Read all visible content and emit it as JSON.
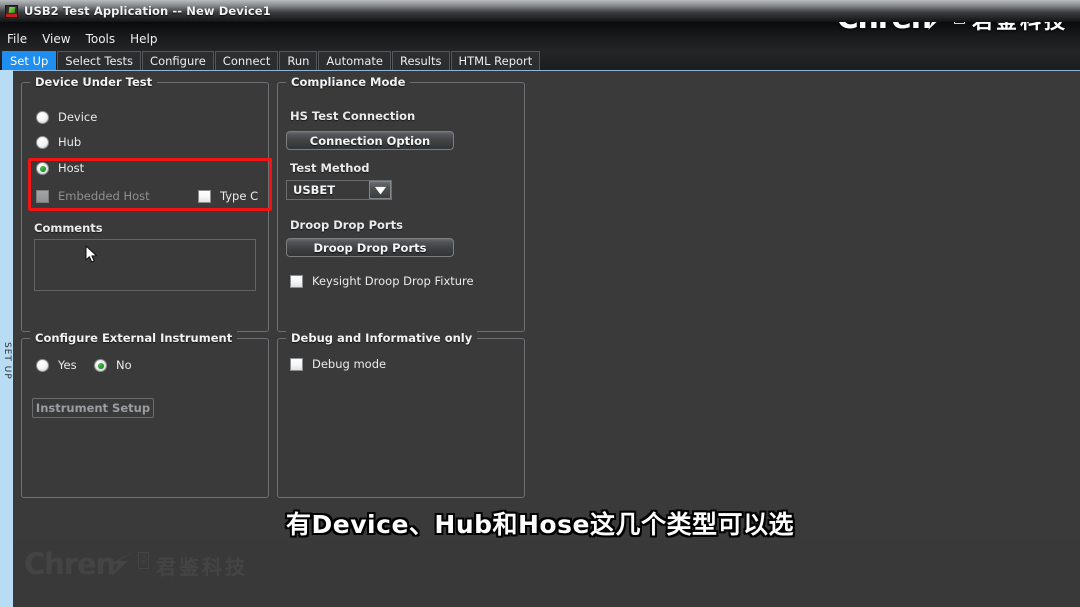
{
  "window": {
    "title": "USB2 Test Application -- New Device1",
    "icon": "app-icon"
  },
  "menubar": {
    "items": [
      {
        "label": "File"
      },
      {
        "label": "View"
      },
      {
        "label": "Tools"
      },
      {
        "label": "Help"
      }
    ]
  },
  "tabs": [
    {
      "label": "Set Up",
      "active": true
    },
    {
      "label": "Select Tests",
      "active": false
    },
    {
      "label": "Configure",
      "active": false
    },
    {
      "label": "Connect",
      "active": false
    },
    {
      "label": "Run",
      "active": false
    },
    {
      "label": "Automate",
      "active": false
    },
    {
      "label": "Results",
      "active": false
    },
    {
      "label": "HTML Report",
      "active": false
    }
  ],
  "brand": {
    "word": "Chren",
    "mark": "注册",
    "chinese": "君鉴科技"
  },
  "side_strip": {
    "label": "SET UP"
  },
  "device_under_test": {
    "title": "Device Under Test",
    "options": [
      {
        "label": "Device",
        "selected": false
      },
      {
        "label": "Hub",
        "selected": false
      },
      {
        "label": "Host",
        "selected": true
      }
    ],
    "embedded_host": {
      "label": "Embedded Host",
      "checked": false,
      "disabled": true
    },
    "type_c": {
      "label": "Type C",
      "checked": false
    },
    "comments": {
      "label": "Comments",
      "value": ""
    }
  },
  "compliance_mode": {
    "title": "Compliance Mode",
    "hs_test_connection_label": "HS Test Connection",
    "connection_option_button": "Connection Option",
    "test_method_label": "Test Method",
    "test_method_value": "USBET",
    "droop_drop_ports_label": "Droop Drop Ports",
    "droop_drop_ports_button": "Droop Drop Ports",
    "keysight_fixture": {
      "label": "Keysight Droop Drop Fixture",
      "checked": false
    }
  },
  "configure_external_instrument": {
    "title": "Configure External Instrument",
    "options": [
      {
        "label": "Yes",
        "selected": false
      },
      {
        "label": "No",
        "selected": true
      }
    ],
    "instrument_setup_button": "Instrument Setup"
  },
  "debug": {
    "title": "Debug and Informative only",
    "debug_mode": {
      "label": "Debug mode",
      "checked": false
    }
  },
  "subtitle": {
    "text": "有Device、Hub和Hose这几个类型可以选"
  },
  "colors": {
    "accent_tab": "#1f8ef1",
    "highlight_box": "#f01414",
    "selected_radio": "#1f8a24",
    "side_strip": "#b9dcf5",
    "panel_bg": "#3a3a3a"
  }
}
